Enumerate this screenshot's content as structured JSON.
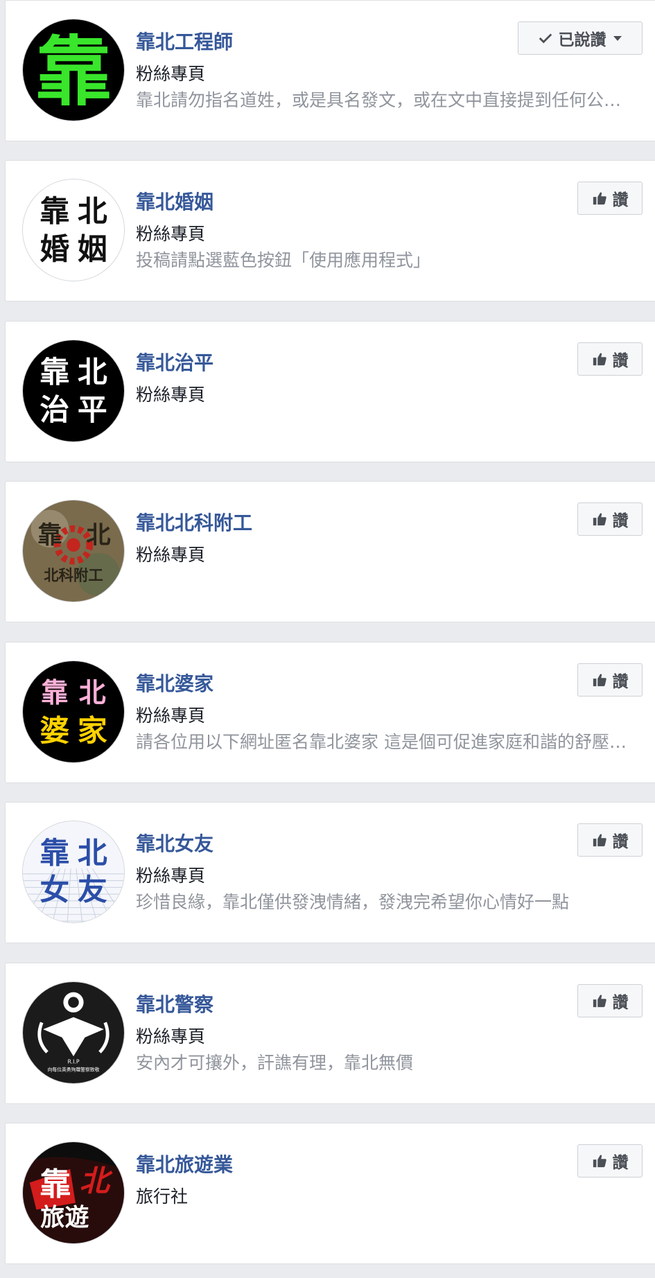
{
  "pages": [
    {
      "name": "靠北工程師",
      "category": "粉絲專頁",
      "description": "靠北請勿指名道姓，或是具名發文，或在文中直接提到任何公…",
      "button": "已說讚",
      "liked": true,
      "avatar_text": [
        "靠"
      ],
      "avatar_colors": {
        "bg": "#000000",
        "fg": "#39e62b"
      }
    },
    {
      "name": "靠北婚姻",
      "category": "粉絲專頁",
      "description": "投稿請點選藍色按鈕「使用應用程式」",
      "button": "讚",
      "liked": false,
      "avatar_text": [
        "靠",
        "北",
        "婚",
        "姻"
      ],
      "avatar_colors": {
        "bg": "#ffffff",
        "fg": "#111111"
      }
    },
    {
      "name": "靠北治平",
      "category": "粉絲專頁",
      "description": "",
      "button": "讚",
      "liked": false,
      "avatar_text": [
        "靠",
        "北",
        "治",
        "平"
      ],
      "avatar_colors": {
        "bg": "#000000",
        "fg": "#ffffff"
      }
    },
    {
      "name": "靠北北科附工",
      "category": "粉絲專頁",
      "description": "",
      "button": "讚",
      "liked": false,
      "avatar_text": [
        "靠",
        "北",
        "北科附工"
      ],
      "avatar_colors": {
        "bg": "#8c7d62",
        "fg": "#2a2418"
      }
    },
    {
      "name": "靠北婆家",
      "category": "粉絲專頁",
      "description": "請各位用以下網址匿名靠北婆家 這是個可促進家庭和諧的舒壓…",
      "button": "讚",
      "liked": false,
      "avatar_text": [
        "靠",
        "北",
        "婆",
        "家"
      ],
      "avatar_colors": {
        "bg": "#000000",
        "fg": "#ffb0d8",
        "fg2": "#ffd200"
      }
    },
    {
      "name": "靠北女友",
      "category": "粉絲專頁",
      "description": "珍惜良緣，靠北僅供發洩情緒，發洩完希望你心情好一點",
      "button": "讚",
      "liked": false,
      "avatar_text": [
        "靠",
        "北",
        "女",
        "友"
      ],
      "avatar_colors": {
        "bg": "#f4f6fb",
        "fg": "#2b4ea8"
      }
    },
    {
      "name": "靠北警察",
      "category": "粉絲專頁",
      "description": "安內才可攘外，訐譙有理，靠北無價",
      "button": "讚",
      "liked": false,
      "avatar_text": [
        "R.I.P",
        "向每位英勇殉職警察致敬"
      ],
      "avatar_colors": {
        "bg": "#1b1b1b",
        "fg": "#ffffff"
      }
    },
    {
      "name": "靠北旅遊業",
      "category": "旅行社",
      "description": "",
      "button": "讚",
      "liked": false,
      "avatar_text": [
        "靠",
        "北",
        "旅遊"
      ],
      "avatar_colors": {
        "bg": "#0d0d0d",
        "fg": "#ffffff",
        "accent": "#d41c1c"
      }
    }
  ]
}
